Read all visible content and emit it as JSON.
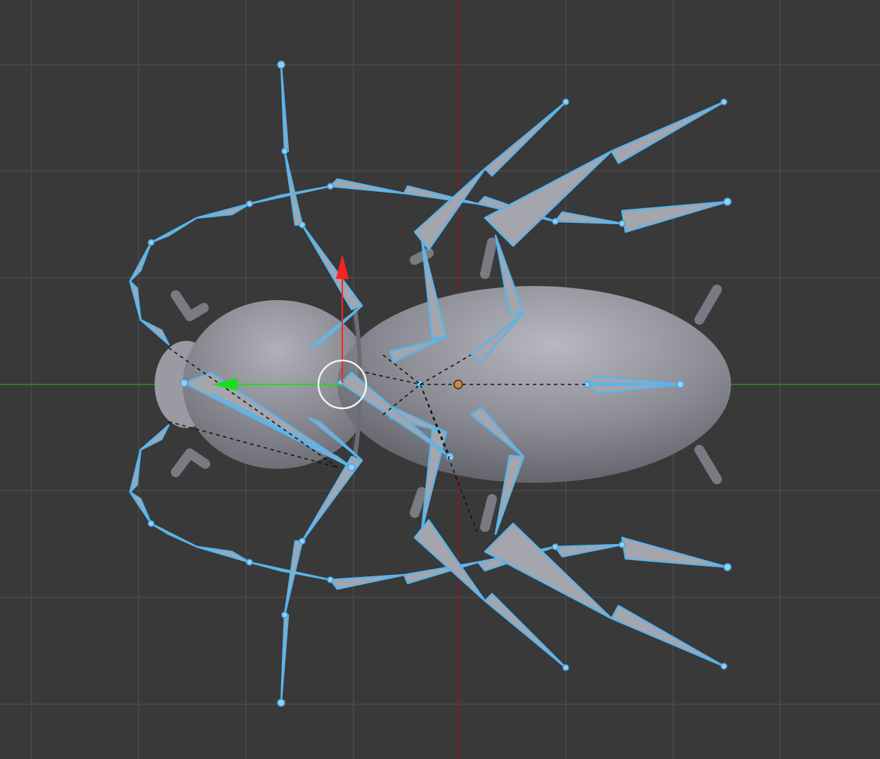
{
  "viewport": {
    "view": "top-orthographic",
    "background_color": "#393939",
    "grid_color": "#4a4a4a",
    "x_axis_color": "#3f8f2f",
    "y_axis_color": "#8a2a2a"
  },
  "scene": {
    "mesh": {
      "name": "beetle-body",
      "color": "#8f8f97"
    },
    "armature": {
      "bone_color": "#a5a5ad",
      "outline_color": "#5ab4ea",
      "selected": true
    },
    "manipulator": {
      "x_arrow_color": "#ff2020",
      "y_arrow_color": "#18e018"
    },
    "origin_color": "#d08a3a"
  }
}
